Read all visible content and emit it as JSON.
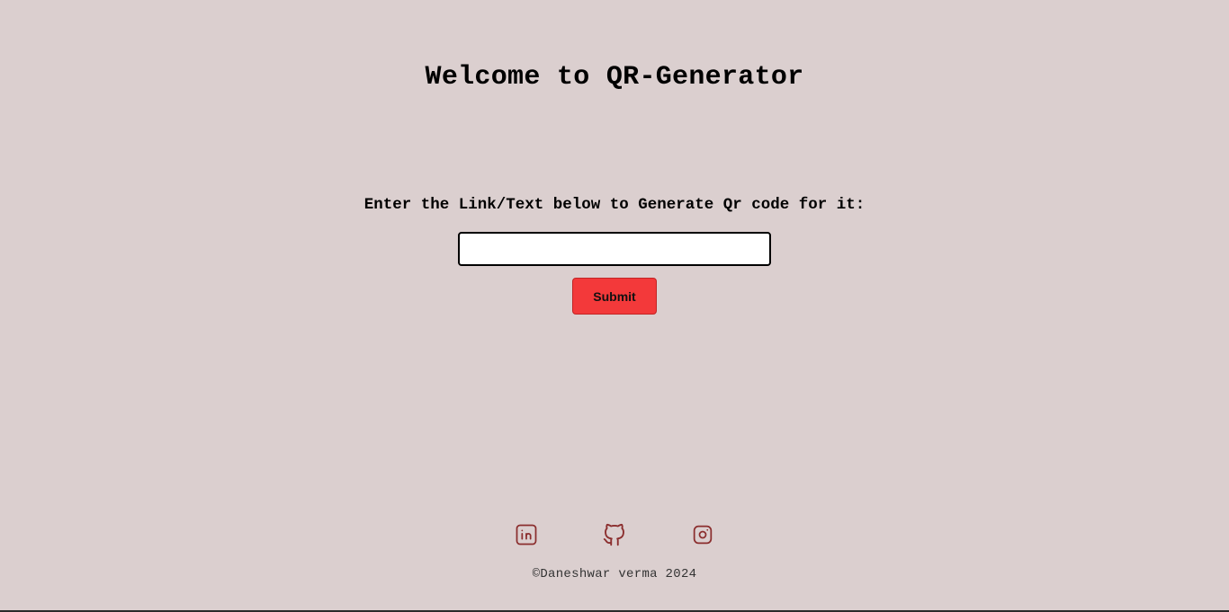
{
  "header": {
    "title": "Welcome to QR-Generator"
  },
  "form": {
    "prompt": "Enter the Link/Text below to Generate Qr code for it:",
    "input_value": "",
    "input_placeholder": "",
    "submit_label": "Submit"
  },
  "footer": {
    "social_icons": [
      "linkedin-icon",
      "github-icon",
      "instagram-icon"
    ],
    "copyright": "©Daneshwar verma 2024"
  },
  "colors": {
    "background": "#dbcfcf",
    "accent": "#f3393a",
    "icon": "#8b2e2e"
  }
}
